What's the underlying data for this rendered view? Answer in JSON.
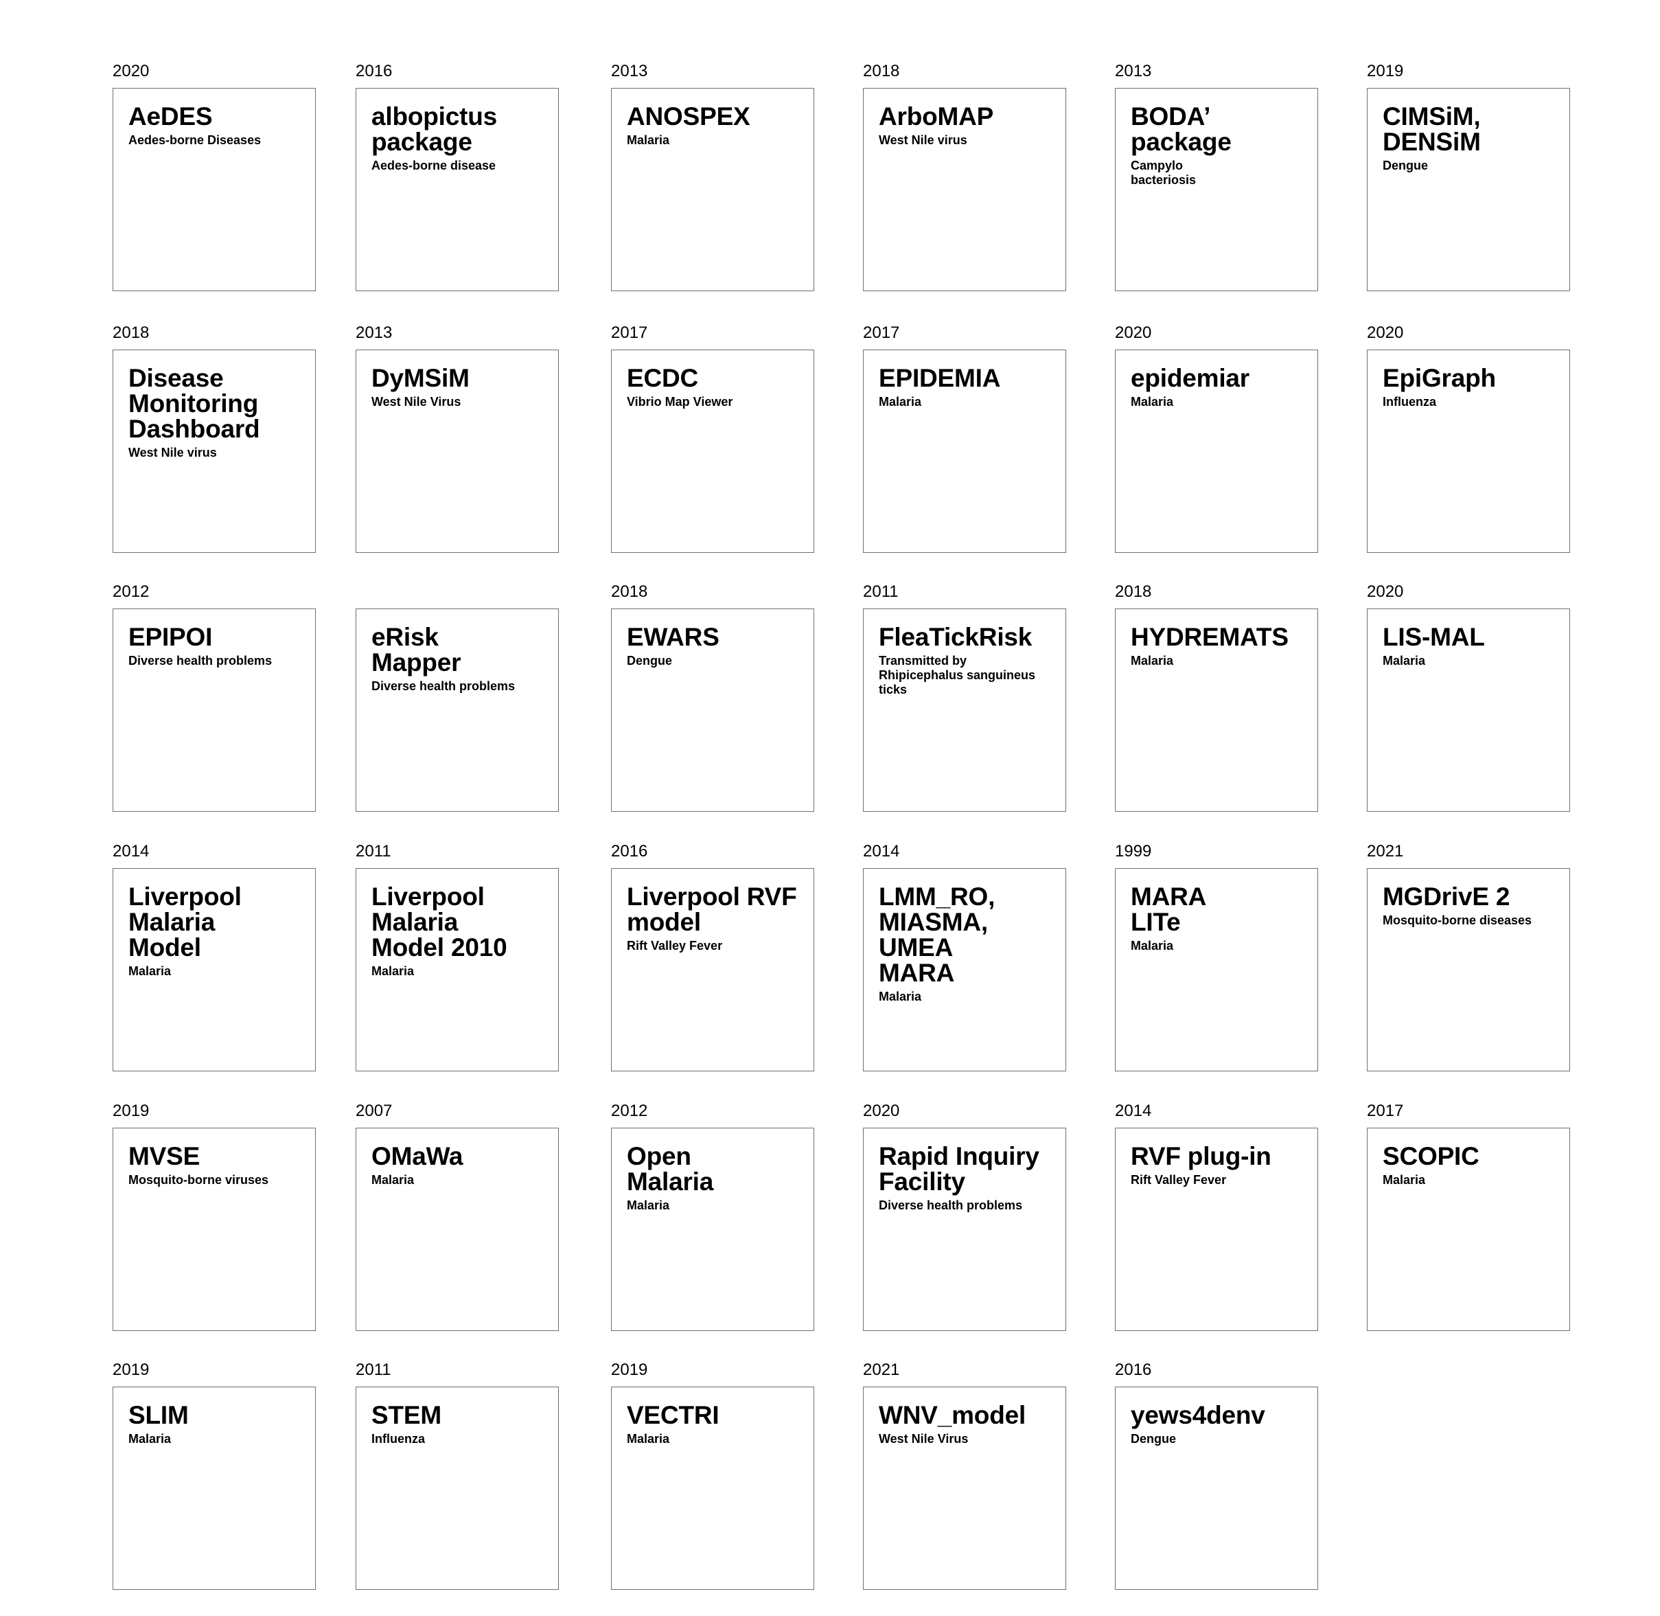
{
  "tools": [
    {
      "year": "2020",
      "name": "AeDES",
      "disease": "Aedes-borne Diseases"
    },
    {
      "year": "2016",
      "name": "albopictus\npackage",
      "disease": "Aedes-borne disease"
    },
    {
      "year": "2013",
      "name": "ANOSPEX",
      "disease": "Malaria"
    },
    {
      "year": "2018",
      "name": "ArboMAP",
      "disease": "West Nile virus"
    },
    {
      "year": "2013",
      "name": "BODA’\npackage",
      "disease": "Campylo\nbacteriosis"
    },
    {
      "year": "2019",
      "name": "CIMSiM,\nDENSiM",
      "disease": "Dengue"
    },
    {
      "year": "2018",
      "name": "Disease\nMonitoring\nDashboard",
      "disease": "West Nile virus"
    },
    {
      "year": "2013",
      "name": "DyMSiM",
      "disease": "West Nile Virus"
    },
    {
      "year": "2017",
      "name": "ECDC",
      "disease": "Vibrio Map Viewer"
    },
    {
      "year": "2017",
      "name": "EPIDEMIA",
      "disease": "Malaria"
    },
    {
      "year": "2020",
      "name": "epidemiar",
      "disease": "Malaria"
    },
    {
      "year": "2020",
      "name": "EpiGraph",
      "disease": "Influenza"
    },
    {
      "year": "2012",
      "name": "EPIPOI",
      "disease": "Diverse health problems"
    },
    {
      "year": "",
      "name": "eRisk\nMapper",
      "disease": "Diverse health problems"
    },
    {
      "year": "2018",
      "name": "EWARS",
      "disease": "Dengue"
    },
    {
      "year": "2011",
      "name": "FleaTickRisk",
      "disease": "Transmitted by\nRhipicephalus sanguineus\nticks"
    },
    {
      "year": "2018",
      "name": "HYDREMATS",
      "disease": "Malaria"
    },
    {
      "year": "2020",
      "name": "LIS-MAL",
      "disease": "Malaria"
    },
    {
      "year": "2014",
      "name": "Liverpool\nMalaria\nModel",
      "disease": "Malaria"
    },
    {
      "year": "2011",
      "name": "Liverpool\nMalaria\nModel 2010",
      "disease": "Malaria"
    },
    {
      "year": "2016",
      "name": "Liverpool RVF\nmodel",
      "disease": "Rift Valley Fever"
    },
    {
      "year": "2014",
      "name": "LMM_RO,\nMIASMA,\nUMEA\nMARA",
      "disease": "Malaria"
    },
    {
      "year": "1999",
      "name": "MARA\nLITe",
      "disease": "Malaria"
    },
    {
      "year": "2021",
      "name": "MGDrivE 2",
      "disease": "Mosquito-borne diseases"
    },
    {
      "year": "2019",
      "name": "MVSE",
      "disease": "Mosquito-borne viruses"
    },
    {
      "year": "2007",
      "name": "OMaWa",
      "disease": "Malaria"
    },
    {
      "year": "2012",
      "name": "Open\nMalaria",
      "disease": "Malaria"
    },
    {
      "year": "2020",
      "name": "Rapid Inquiry\nFacility",
      "disease": "Diverse health problems"
    },
    {
      "year": "2014",
      "name": "RVF plug-in",
      "disease": "Rift Valley Fever"
    },
    {
      "year": "2017",
      "name": "SCOPIC",
      "disease": "Malaria"
    },
    {
      "year": "2019",
      "name": "SLIM",
      "disease": "Malaria"
    },
    {
      "year": "2011",
      "name": "STEM",
      "disease": "Influenza"
    },
    {
      "year": "2019",
      "name": "VECTRI",
      "disease": "Malaria"
    },
    {
      "year": "2021",
      "name": "WNV_model",
      "disease": "West Nile Virus"
    },
    {
      "year": "2016",
      "name": "yews4denv",
      "disease": "Dengue"
    }
  ]
}
